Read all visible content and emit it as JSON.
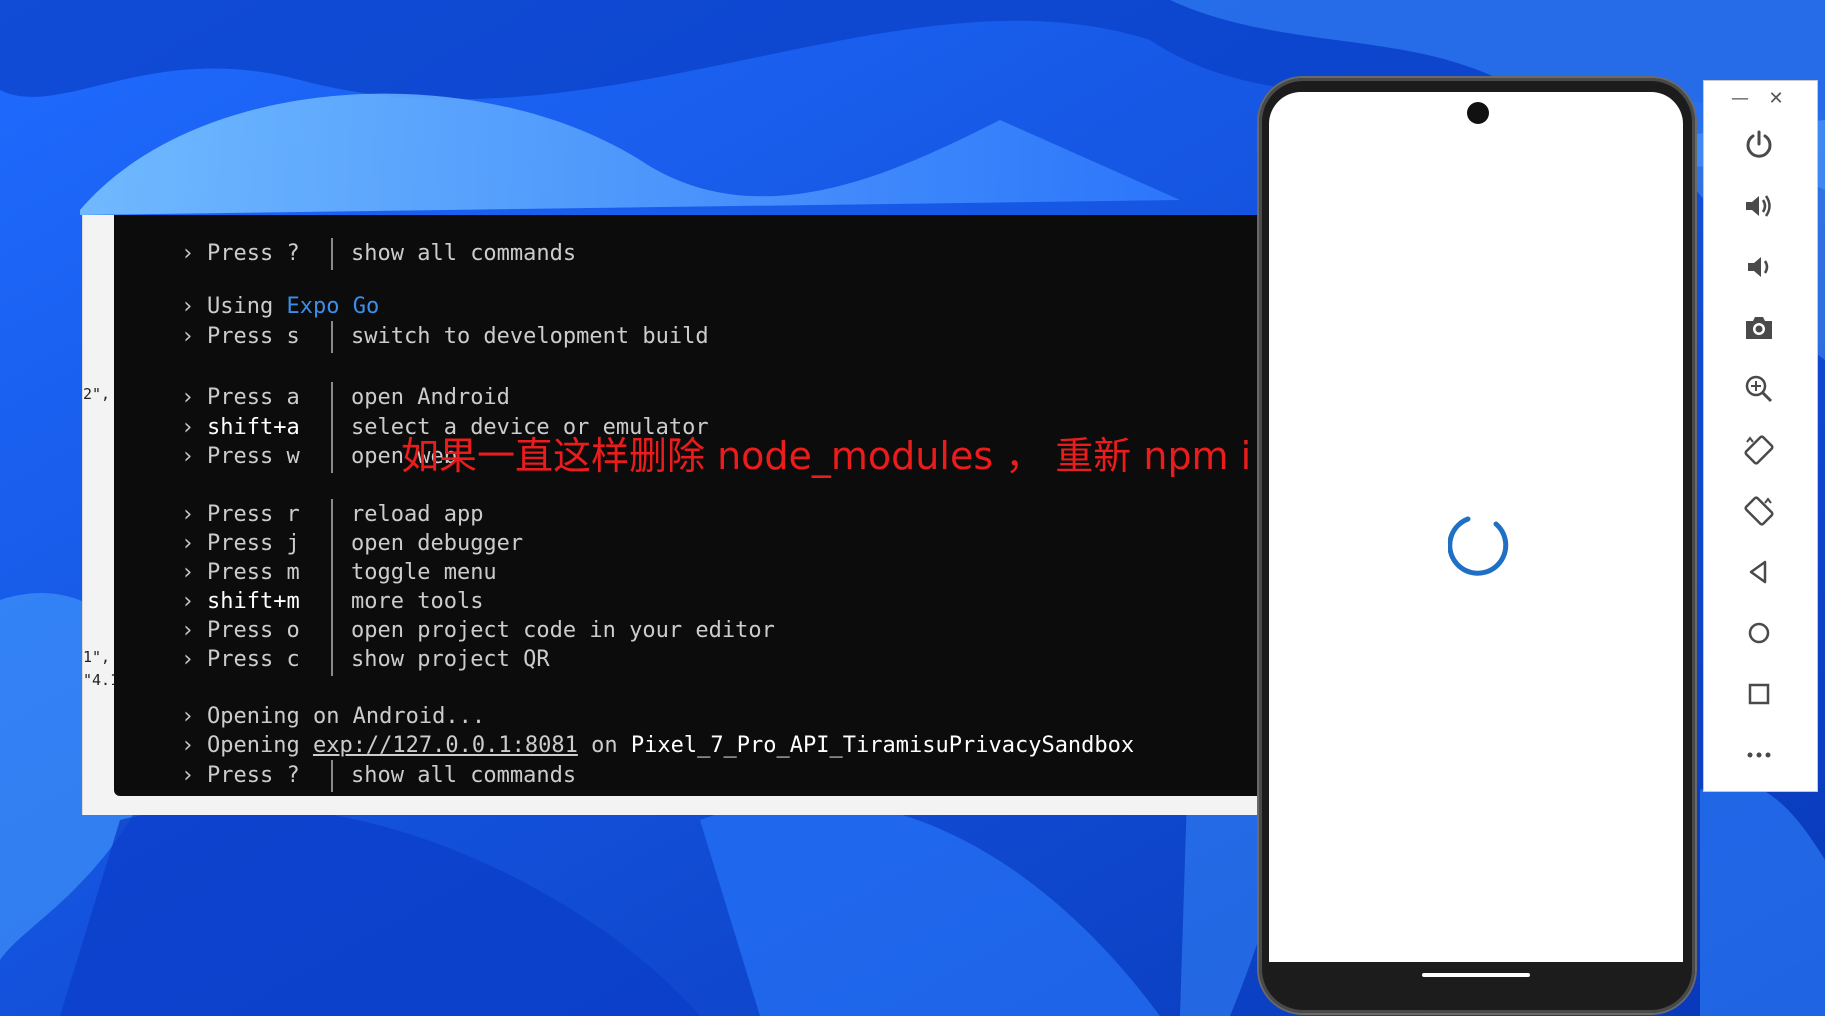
{
  "terminal": {
    "lines": [
      {
        "prefix": "›",
        "key": "Press ?",
        "desc": "show all commands"
      },
      {
        "prefix": "›",
        "text_a": "Using ",
        "kw": "Expo Go"
      },
      {
        "prefix": "›",
        "key": "Press s",
        "desc": "switch to development build"
      },
      {
        "prefix": "›",
        "key": "Press a",
        "desc": "open Android"
      },
      {
        "prefix": "›",
        "key": "shift+a",
        "desc": "select a device or emulator"
      },
      {
        "prefix": "›",
        "key": "Press w",
        "desc": "open web"
      },
      {
        "prefix": "›",
        "key": "Press r",
        "desc": "reload app"
      },
      {
        "prefix": "›",
        "key": "Press j",
        "desc": "open debugger"
      },
      {
        "prefix": "›",
        "key": "Press m",
        "desc": "toggle menu"
      },
      {
        "prefix": "›",
        "key": "shift+m",
        "desc": "more tools"
      },
      {
        "prefix": "›",
        "key": "Press o",
        "desc": "open project code in your editor"
      },
      {
        "prefix": "›",
        "key": "Press c",
        "desc": "show project QR"
      },
      {
        "prefix": "›",
        "text_a": "Opening on Android..."
      },
      {
        "prefix": "›",
        "text_a": "Opening ",
        "url": "exp://127.0.0.1:8081",
        "text_b": " on ",
        "device": "Pixel_7_Pro_API_TiramisuPrivacySandbox"
      },
      {
        "prefix": "›",
        "key": "Press ?",
        "desc": "show all commands"
      }
    ]
  },
  "annotation": "如果一直这样删除 node_modules ， 重新 npm i",
  "editor_fragments": [
    "2\",",
    "1\",",
    "\"4.1"
  ],
  "emulator": {
    "minimize": "—",
    "close": "✕",
    "buttons": [
      "power-icon",
      "volume-up-icon",
      "volume-down-icon",
      "camera-icon",
      "zoom-icon",
      "rotate-left-icon",
      "rotate-right-icon",
      "back-icon",
      "home-icon",
      "overview-icon",
      "more-icon"
    ]
  },
  "colors": {
    "terminal_bg": "#0c0c0c",
    "terminal_text": "#cccccc",
    "expo_go": "#3b8eea",
    "annotation": "#ea1c1c",
    "spinner": "#1f6fc4",
    "toolbar_icon": "#4a4a4a"
  }
}
